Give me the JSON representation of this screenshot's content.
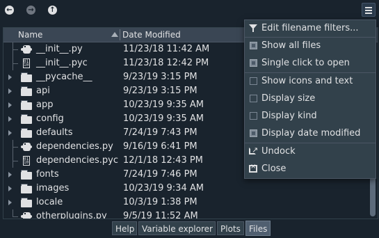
{
  "toolbar": {
    "back_icon": "arrow-left-icon",
    "forward_icon": "arrow-right-icon",
    "up_icon": "arrow-up-icon",
    "menu_icon": "hamburger-menu-icon"
  },
  "columns": {
    "name": "Name",
    "date_modified": "Date Modified"
  },
  "rows": [
    {
      "name": "__init__.py",
      "date": "11/23/18 11:42 AM",
      "type": "py",
      "expandable": false
    },
    {
      "name": "__init__.pyc",
      "date": "11/23/18 12:42 PM",
      "type": "pyc",
      "expandable": false
    },
    {
      "name": "__pycache__",
      "date": "9/23/19 3:15 PM",
      "type": "folder",
      "expandable": true
    },
    {
      "name": "api",
      "date": "9/23/19 3:15 PM",
      "type": "folder",
      "expandable": true
    },
    {
      "name": "app",
      "date": "10/23/19 9:35 AM",
      "type": "folder",
      "expandable": true
    },
    {
      "name": "config",
      "date": "10/23/19 9:35 AM",
      "type": "folder",
      "expandable": true
    },
    {
      "name": "defaults",
      "date": "7/24/19 7:43 PM",
      "type": "folder",
      "expandable": true
    },
    {
      "name": "dependencies.py",
      "date": "9/16/19 6:41 PM",
      "type": "py",
      "expandable": false
    },
    {
      "name": "dependencies.pyc",
      "date": "12/1/18 12:43 PM",
      "type": "pyc",
      "expandable": false
    },
    {
      "name": "fonts",
      "date": "7/24/19 7:46 PM",
      "type": "folder",
      "expandable": true
    },
    {
      "name": "images",
      "date": "10/23/19 9:34 AM",
      "type": "folder",
      "expandable": true
    },
    {
      "name": "locale",
      "date": "10/3/19 1:38 PM",
      "type": "folder",
      "expandable": true
    },
    {
      "name": "otherplugins.py",
      "date": "9/5/19 11:52 AM",
      "type": "py",
      "expandable": false
    }
  ],
  "menu": {
    "items": [
      {
        "label": "Edit filename filters...",
        "kind": "icon",
        "icon": "filter-icon"
      },
      {
        "label": "Show all files",
        "kind": "checkbox",
        "checked": true
      },
      {
        "label": "Single click to open",
        "kind": "checkbox",
        "checked": true
      },
      {
        "label": "Show icons and text",
        "kind": "checkbox",
        "checked": false
      },
      {
        "label": "Display size",
        "kind": "checkbox",
        "checked": false
      },
      {
        "label": "Display kind",
        "kind": "checkbox",
        "checked": false
      },
      {
        "label": "Display date modified",
        "kind": "checkbox",
        "checked": true
      },
      {
        "label": "Undock",
        "kind": "icon",
        "icon": "undock-icon"
      },
      {
        "label": "Close",
        "kind": "icon",
        "icon": "close-icon"
      }
    ]
  },
  "tabs": [
    {
      "label": "Help",
      "active": false
    },
    {
      "label": "Variable explorer",
      "active": false
    },
    {
      "label": "Plots",
      "active": false
    },
    {
      "label": "Files",
      "active": true
    }
  ],
  "colors": {
    "background": "#19232d",
    "panel": "#32414b",
    "text": "#e0e1e3",
    "accent": "#505f70"
  }
}
